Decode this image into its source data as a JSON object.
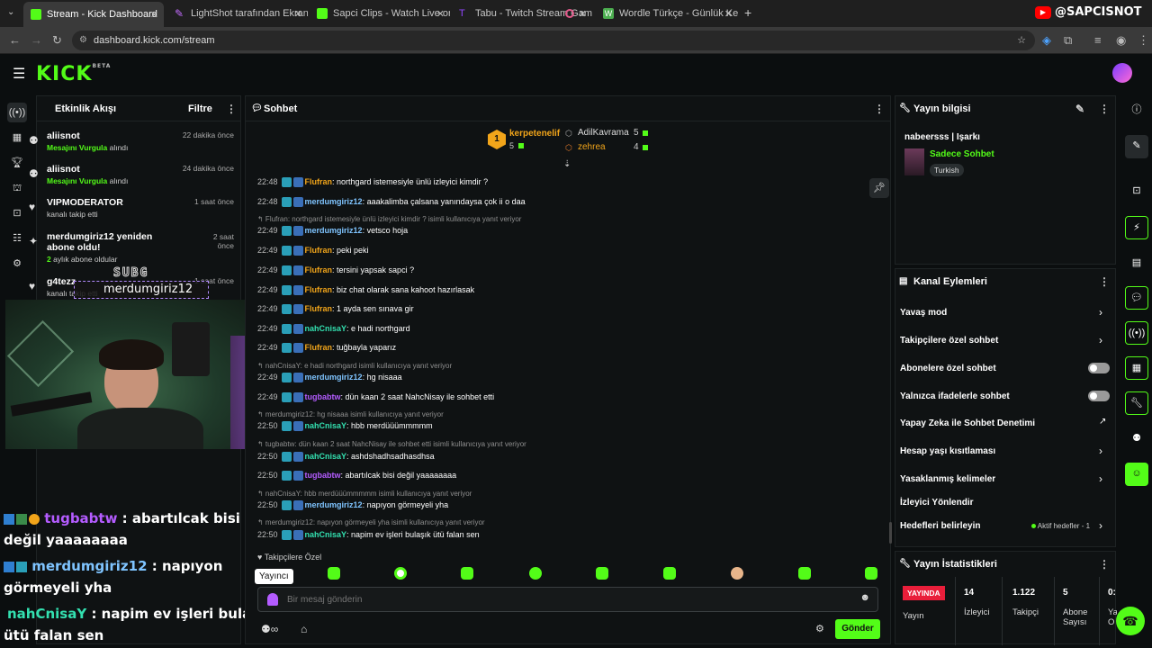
{
  "browser": {
    "tabs": [
      {
        "title": "Stream - Kick Dashboard",
        "active": true,
        "color": "#53fc18"
      },
      {
        "title": "LightShot tarafından Ekran Gör",
        "active": false,
        "color": "#c36bff"
      },
      {
        "title": "Sapci Clips - Watch Live on Kick",
        "active": false,
        "color": "#53fc18"
      },
      {
        "title": "Tabu - Twitch Stream Game",
        "active": false,
        "color": "#9146ff"
      },
      {
        "title": "Wordle Türkçe - Günlük Kelime",
        "active": false,
        "color": "#4caf50"
      }
    ],
    "url": "dashboard.kick.com/stream",
    "yt_handle": "@SAPCISNOT"
  },
  "kick": {
    "logo": "KICK",
    "beta": "BETA"
  },
  "activity": {
    "title": "Etkinlik Akışı",
    "filter": "Filtre",
    "items": [
      {
        "name": "aliisnot",
        "highlight": "Mesajını Vurgula",
        "rest": " alındı",
        "time": "22 dakika önce"
      },
      {
        "name": "aliisnot",
        "highlight": "Mesajını Vurgula",
        "rest": " alındı",
        "time": "24 dakika önce"
      },
      {
        "name": "VIPMODERATOR",
        "highlight": "",
        "rest": "kanalı takip etti",
        "time": "1 saat önce"
      },
      {
        "name": "merdumgiriz12 yeniden abone oldu!",
        "highlight": "2",
        "rest": " aylık abone oldular",
        "time": "2 saat önce"
      },
      {
        "name": "g4tezz",
        "highlight": "",
        "rest": "kanalı takip etti",
        "time": "1 saat önce"
      }
    ]
  },
  "overlay": {
    "sub_label": "SUBG",
    "sub_name": "merdumgiriz12",
    "chat": [
      {
        "user": "tugbabtw",
        "color": "#b45cff",
        "msg": " : abartılcak bisi",
        "msg2": "değil yaaaaaaaa"
      },
      {
        "user": "merdumgiriz12",
        "color": "#7fc4ff",
        "msg": " : napıyon",
        "msg2": "görmeyeli yha"
      },
      {
        "user": "nahCnisaY",
        "color": "#33e0b0",
        "msg": " : napim ev işleri bulaşık",
        "msg2": "ütü falan sen"
      }
    ]
  },
  "chat": {
    "title": "Sohbet",
    "leaders": {
      "first": {
        "rank": "1",
        "name": "kerpetenelif",
        "count": "5"
      },
      "second": {
        "name": "AdilKavrama",
        "count": "5"
      },
      "third": {
        "name": "zehrea",
        "count": "4"
      }
    },
    "lines": [
      {
        "time": "22:48",
        "user": "Flufran",
        "color": "#f2a51a",
        "msg": ": northgard istemesiyle ünlü izleyici kimdir ?",
        "reply": ""
      },
      {
        "time": "22:48",
        "user": "merdumgiriz12",
        "color": "#7fc4ff",
        "msg": ": aaakalimba çalsana yanındaysa çok ii o daa",
        "reply": ""
      },
      {
        "time": "22:49",
        "user": "merdumgiriz12",
        "color": "#7fc4ff",
        "msg": ": vetsco hoja",
        "reply": "Flufran: northgard istemesiyle ünlü izleyici kimdir ? isimli kullanıcıya yanıt veriyor"
      },
      {
        "time": "22:49",
        "user": "Flufran",
        "color": "#f2a51a",
        "msg": ": peki peki",
        "reply": ""
      },
      {
        "time": "22:49",
        "user": "Flufran",
        "color": "#f2a51a",
        "msg": ": tersini yapsak sapci ?",
        "reply": ""
      },
      {
        "time": "22:49",
        "user": "Flufran",
        "color": "#f2a51a",
        "msg": ": biz chat olarak sana kahoot hazırlasak",
        "reply": ""
      },
      {
        "time": "22:49",
        "user": "Flufran",
        "color": "#f2a51a",
        "msg": ": 1 ayda sen sınava gir",
        "reply": ""
      },
      {
        "time": "22:49",
        "user": "nahCnisaY",
        "color": "#33e0b0",
        "msg": ": e hadi northgard",
        "reply": ""
      },
      {
        "time": "22:49",
        "user": "Flufran",
        "color": "#f2a51a",
        "msg": ": tuğbayla yaparız",
        "reply": ""
      },
      {
        "time": "22:49",
        "user": "merdumgiriz12",
        "color": "#7fc4ff",
        "msg": ": hg nisaaa",
        "reply": "nahCnisaY: e hadi northgard isimli kullanıcıya yanıt veriyor"
      },
      {
        "time": "22:49",
        "user": "tugbabtw",
        "color": "#b45cff",
        "msg": ": dün kaan 2 saat NahcNisay ile sohbet etti",
        "reply": ""
      },
      {
        "time": "22:50",
        "user": "nahCnisaY",
        "color": "#33e0b0",
        "msg": ": hbb merdüüümmmmm",
        "reply": "merdumgiriz12: hg nisaaa isimli kullanıcıya yanıt veriyor"
      },
      {
        "time": "22:50",
        "user": "nahCnisaY",
        "color": "#33e0b0",
        "msg": ": ashdshadhsadhasdhsa",
        "reply": "tugbabtw: dün kaan 2 saat NahcNisay ile sohbet etti isimli kullanıcıya yanıt veriyor"
      },
      {
        "time": "22:50",
        "user": "tugbabtw",
        "color": "#b45cff",
        "msg": ": abartılcak bisi değil yaaaaaaaa",
        "reply": ""
      },
      {
        "time": "22:50",
        "user": "merdumgiriz12",
        "color": "#7fc4ff",
        "msg": ": napıyon görmeyeli yha",
        "reply": "nahCnisaY: hbb merdüüümmmmm isimli kullanıcıya yanıt veriyor"
      },
      {
        "time": "22:50",
        "user": "nahCnisaY",
        "color": "#33e0b0",
        "msg": ": napim ev işleri bulaşık ütü falan sen",
        "reply": "merdumgiriz12: napıyon görmeyeli yha isimli kullanıcıya yanıt veriyor"
      }
    ],
    "followers_only": "Takipçilere Özel",
    "tooltip": "Yayıncı",
    "placeholder": "Bir mesaj gönderin",
    "send": "Gönder"
  },
  "stream_info": {
    "title": "Yayın bilgisi",
    "stream_title": "nabeersss | Işarkı",
    "category": "Sadece Sohbet",
    "language": "Turkish"
  },
  "channel_actions": {
    "title": "Kanal Eylemleri",
    "items": [
      {
        "label": "Yavaş mod",
        "control": "chevron"
      },
      {
        "label": "Takipçilere özel sohbet",
        "control": "chevron"
      },
      {
        "label": "Abonelere özel sohbet",
        "control": "toggle"
      },
      {
        "label": "Yalnızca ifadelerle sohbet",
        "control": "toggle"
      },
      {
        "label": "Yapay Zeka ile Sohbet Denetimi",
        "control": "external"
      },
      {
        "label": "Hesap yaşı kısıtlaması",
        "control": "chevron"
      },
      {
        "label": "Yasaklanmış kelimeler",
        "control": "chevron"
      },
      {
        "label": "İzleyici Yönlendir",
        "control": "none"
      },
      {
        "label": "Hedefleri belirleyin",
        "control": "chevron"
      }
    ],
    "goals_badge": "Aktif hedefler - 1"
  },
  "stats": {
    "title": "Yayın İstatistikleri",
    "live": "YAYINDA",
    "live_label": "Yayın",
    "cells": [
      {
        "value": "14",
        "label": "İzleyici"
      },
      {
        "value": "1.122",
        "label": "Takipçi"
      },
      {
        "value": "5",
        "label": "Abone Sayısı"
      },
      {
        "value": "0:",
        "label": "Ya O"
      }
    ]
  },
  "colors": {
    "kick_green": "#53fc18",
    "live_red": "#e91e3a"
  }
}
